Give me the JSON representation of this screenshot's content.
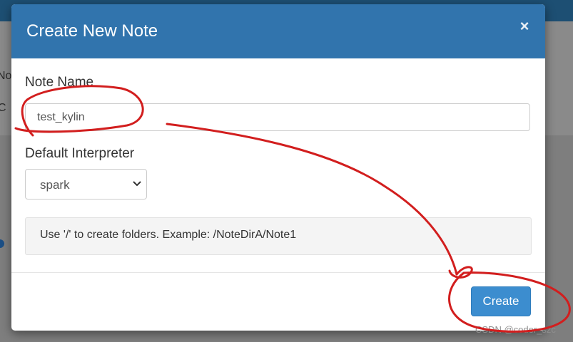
{
  "background": {
    "fragment_1": "No",
    "fragment_2": "C"
  },
  "modal": {
    "title": "Create New Note",
    "close_symbol": "×",
    "note_name_label": "Note Name",
    "note_name_value": "test_kylin",
    "interpreter_label": "Default Interpreter",
    "interpreter_selected": "spark",
    "help_text": "Use '/' to create folders. Example: /NoteDirA/Note1",
    "create_label": "Create"
  },
  "watermark": "CSDN @coder_szc",
  "colors": {
    "header": "#3174ad",
    "primary_button": "#3c8dcf",
    "annotation": "#d21e1e"
  },
  "icons": {
    "close": "close-icon",
    "select": "chevron-down-icon"
  }
}
